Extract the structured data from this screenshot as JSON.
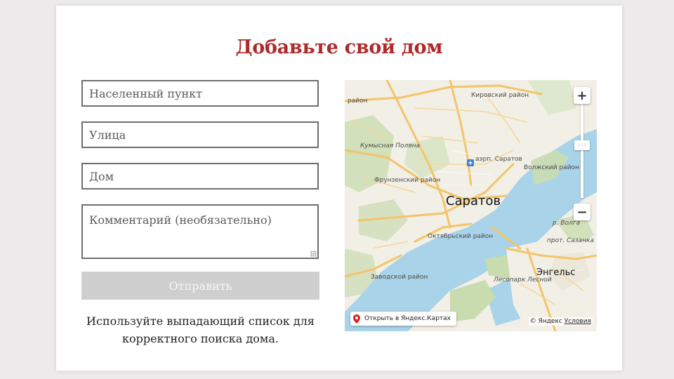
{
  "form": {
    "title": "Добавьте свой дом",
    "locality_placeholder": "Населенный пункт",
    "street_placeholder": "Улица",
    "house_placeholder": "Дом",
    "comment_placeholder": "Комментарий (необязательно)",
    "submit_label": "Отправить",
    "hint": "Используйте выпадающий список для корректного поиска дома."
  },
  "map": {
    "city": "Саратов",
    "city2": "Энгельс",
    "labels": {
      "kirovsky": "Кировский район",
      "volzhsky": "Волжский район",
      "airport": "аэрп. Саратов",
      "kumysnaya": "Кумысная Поляна",
      "frunzensky": "Фрунзенский район",
      "oktyabrsky": "Октябрьский район",
      "zavodskoy": "Заводской район",
      "volga": "р. Волга",
      "sazanka": "прот. Сазанка",
      "lesnoy": "Лесопарк Лесной",
      "raion_top": "район"
    },
    "zoom_in": "+",
    "zoom_out": "−",
    "zoom_handle": ":::",
    "open_link": "Открыть в Яндекс.Картах",
    "copyright": "© Яндекс",
    "terms": "Условия"
  },
  "colors": {
    "accent": "#b02a2a",
    "water": "#a9d3e8",
    "road": "#f3c46a",
    "park": "#c9dcb0"
  }
}
